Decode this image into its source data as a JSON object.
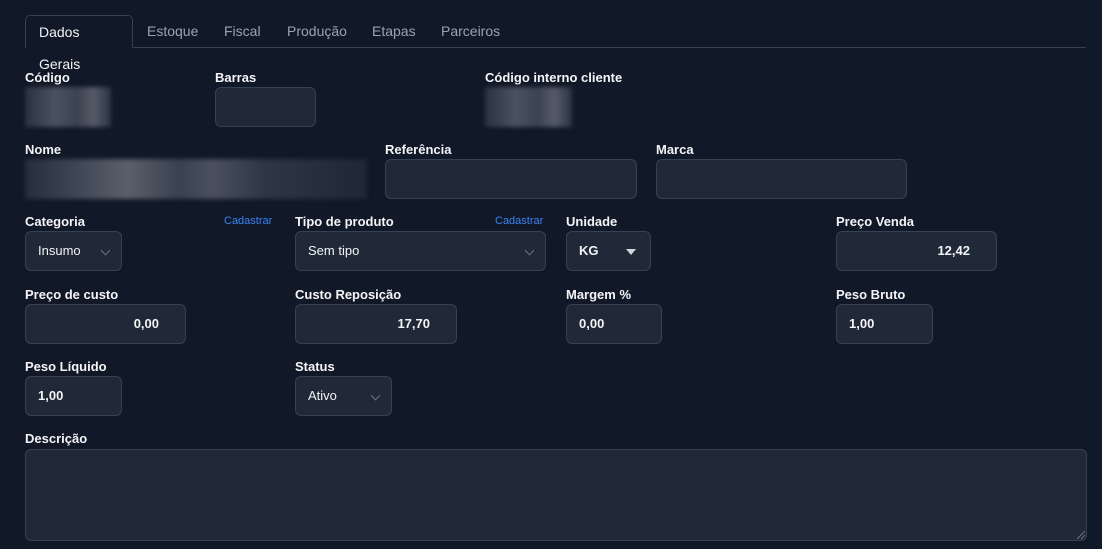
{
  "tabs": [
    "Dados Gerais",
    "Estoque",
    "Fiscal",
    "Produção",
    "Etapas",
    "Parceiros"
  ],
  "active_tab": "Dados Gerais",
  "form": {
    "codigo_label": "Código",
    "barras_label": "Barras",
    "barras_value": "",
    "codigo_interno_label": "Código interno cliente",
    "nome_label": "Nome",
    "referencia_label": "Referência",
    "referencia_value": "",
    "marca_label": "Marca",
    "marca_value": "",
    "categoria_label": "Categoria",
    "categoria_link": "Cadastrar",
    "categoria_value": "Insumo",
    "tipo_label": "Tipo de produto",
    "tipo_link": "Cadastrar",
    "tipo_value": "Sem tipo",
    "unidade_label": "Unidade",
    "unidade_value": "KG",
    "preco_venda_label": "Preço Venda",
    "preco_venda_value": "12,42",
    "preco_custo_label": "Preço de custo",
    "preco_custo_value": "0,00",
    "custo_reposicao_label": "Custo Reposição",
    "custo_reposicao_value": "17,70",
    "margem_label": "Margem %",
    "margem_value": "0,00",
    "peso_bruto_label": "Peso Bruto",
    "peso_bruto_value": "1,00",
    "peso_liquido_label": "Peso Líquido",
    "peso_liquido_value": "1,00",
    "status_label": "Status",
    "status_value": "Ativo",
    "descricao_label": "Descrição",
    "descricao_value": ""
  }
}
